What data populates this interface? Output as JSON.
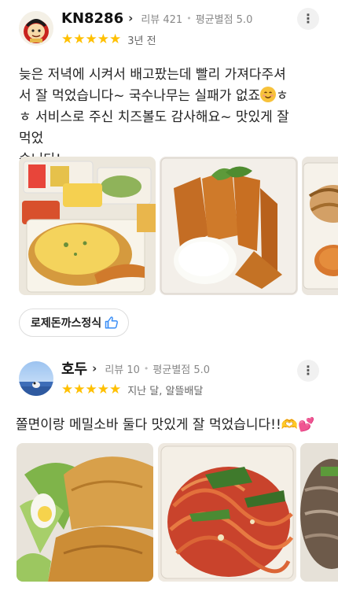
{
  "reviews": [
    {
      "nickname": "KN8286",
      "review_count_label": "리뷰 421",
      "avg_rating_label": "평균별점 5.0",
      "stars": "★★★★★",
      "rating": 5,
      "date": "3년 전",
      "text": "늦은 저녁에 시켜서 배고팠는데 빨리 가져다주셔서 잘 먹었습니다~ 국수나무는 실패가 없죠😊ㅎㅎ 서비스로 주신 치즈볼도 감사해요~ 맛있게 잘 먹었습니다!",
      "text_lines": [
        "늦은 저녁에 시켜서 배고팠는데 빨리 가져다주셔",
        "서 잘 먹었습니다~ 국수나무는 실패가 없죠",
        "ㅎ 서비스로 주신 치즈볼도 감사해요~ 맛있게 잘 먹었",
        "습니다!"
      ],
      "text_line2_suffix": "ㅎ",
      "menu_tag": "로제돈까스정식"
    },
    {
      "nickname": "호두",
      "review_count_label": "리뷰 10",
      "avg_rating_label": "평균별점 5.0",
      "stars": "★★★★★",
      "rating": 5,
      "date": "지난 달, 알뜰배달",
      "text": "쫄면이랑 메밀소바 둘다 맛있게 잘 먹었습니다!!🫶💕"
    }
  ],
  "icons": {
    "chevron": "chevron-right-icon",
    "more": "more-vertical-icon",
    "like": "thumbs-up-icon"
  },
  "glyphs": {
    "chevron": "›",
    "more": "⋮",
    "dot": "•"
  },
  "colors": {
    "star": "#ffc000",
    "thumb": "#3a8ef6"
  }
}
